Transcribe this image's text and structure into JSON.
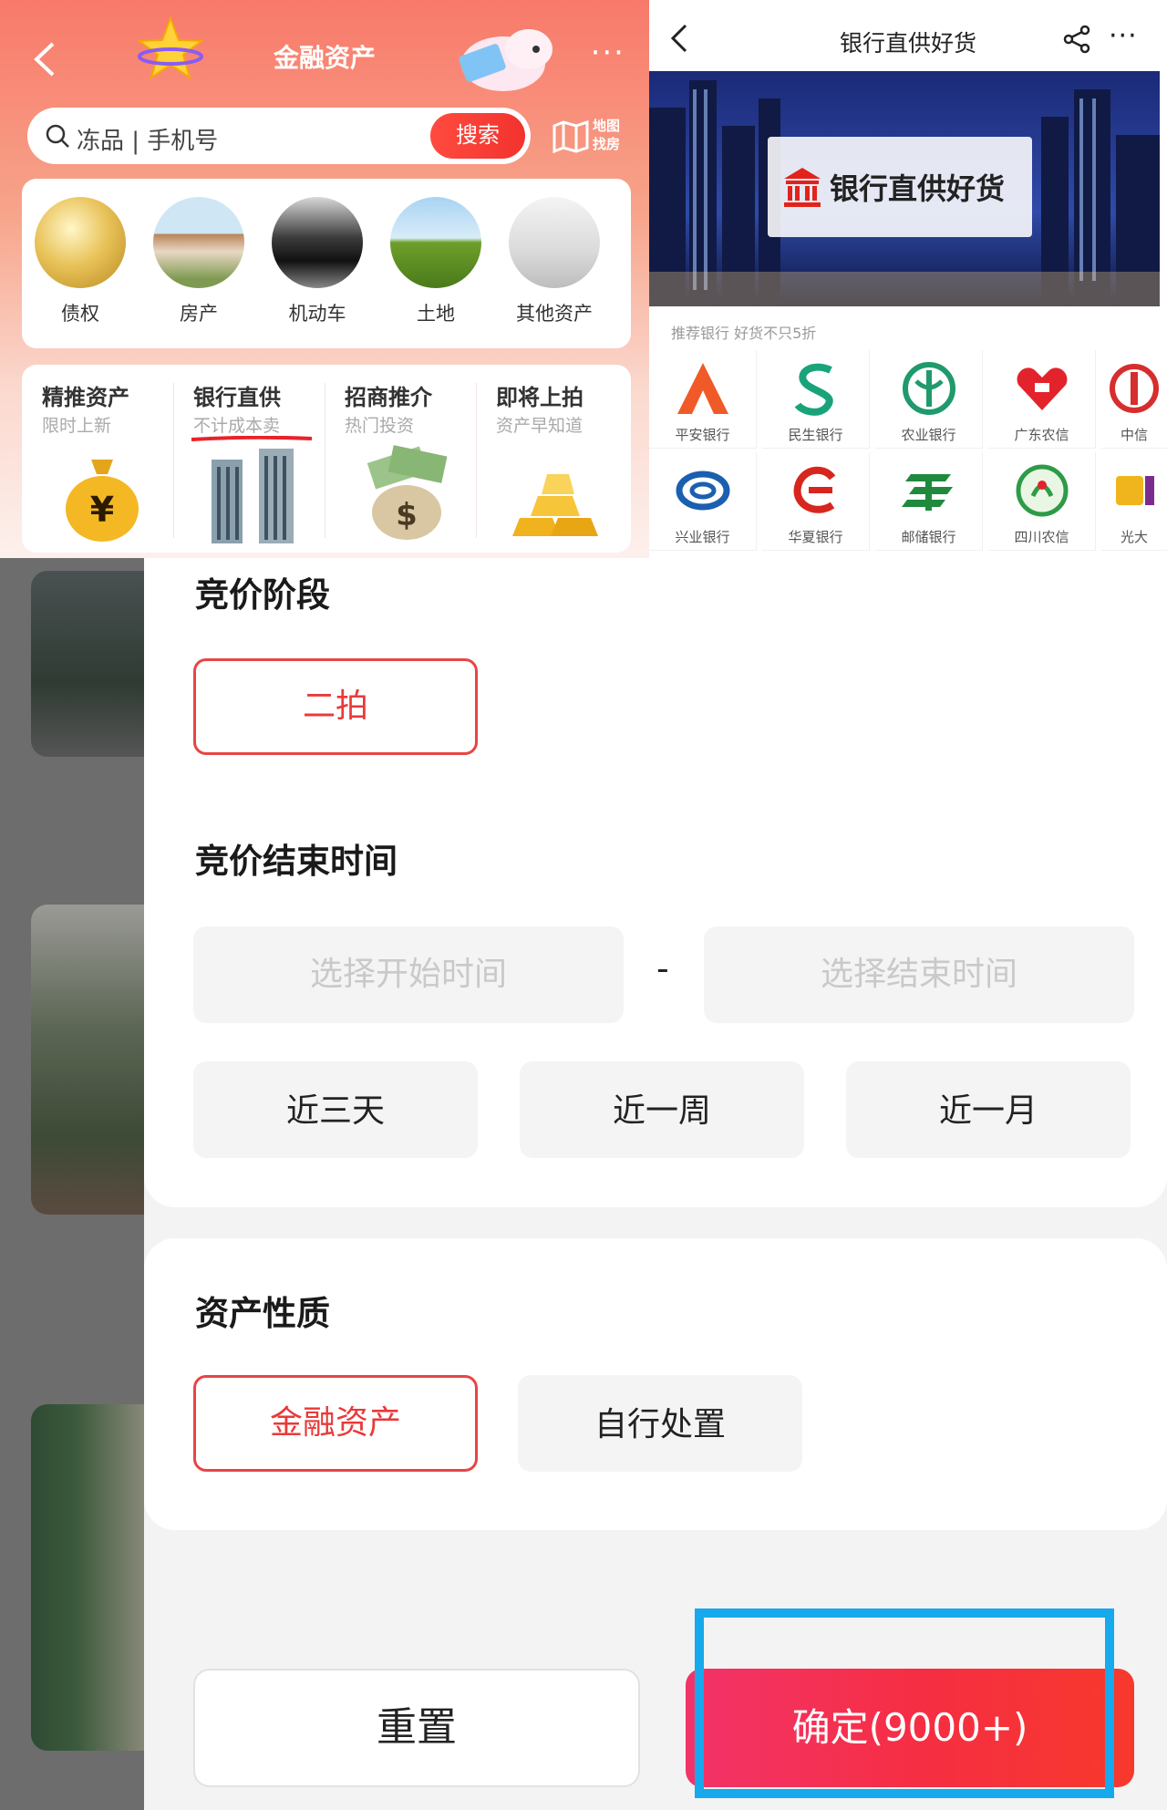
{
  "finance_app": {
    "title": "金融资产",
    "more": "···",
    "search": {
      "placeholder": "冻品 | 手机号",
      "button": "搜索"
    },
    "map_search_label": "地图找房",
    "categories": [
      {
        "label": "债权",
        "icon": "gold-coins-icon"
      },
      {
        "label": "房产",
        "icon": "house-icon"
      },
      {
        "label": "机动车",
        "icon": "car-icon"
      },
      {
        "label": "土地",
        "icon": "land-icon"
      },
      {
        "label": "其他资产",
        "icon": "appliance-icon"
      }
    ],
    "promos": [
      {
        "title": "精推资产",
        "subtitle": "限时上新",
        "icon": "money-bag-icon"
      },
      {
        "title": "银行直供",
        "subtitle": "不计成本卖",
        "icon": "buildings-icon"
      },
      {
        "title": "招商推介",
        "subtitle": "热门投资",
        "icon": "cash-bag-icon"
      },
      {
        "title": "即将上拍",
        "subtitle": "资产早知道",
        "icon": "gold-bars-icon"
      }
    ]
  },
  "bank_page": {
    "title": "银行直供好货",
    "more": "···",
    "banner_text": "银行直供好货",
    "recommend_text": "推荐银行 好货不只5折",
    "banks": [
      {
        "name": "平安银行",
        "color": "#f05a28"
      },
      {
        "name": "民生银行",
        "color": "#1aa37a"
      },
      {
        "name": "农业银行",
        "color": "#1f9a6c"
      },
      {
        "name": "广东农信",
        "color": "#e3232c"
      },
      {
        "name": "中信",
        "color": "#d72d2d"
      },
      {
        "name": "兴业银行",
        "color": "#1b5fb0"
      },
      {
        "name": "华夏银行",
        "color": "#d7261e"
      },
      {
        "name": "邮储银行",
        "color": "#1f8a3d"
      },
      {
        "name": "四川农信",
        "color": "#2d9b47"
      },
      {
        "name": "光大",
        "color": "#f0b51c"
      }
    ]
  },
  "filter": {
    "stage": {
      "title": "竞价阶段",
      "options": [
        "二拍"
      ],
      "selected": "二拍"
    },
    "end_time": {
      "title": "竞价结束时间",
      "start_placeholder": "选择开始时间",
      "separator": "-",
      "end_placeholder": "选择结束时间",
      "quick": [
        "近三天",
        "近一周",
        "近一月"
      ]
    },
    "asset_nature": {
      "title": "资产性质",
      "options": [
        "金融资产",
        "自行处置"
      ],
      "selected": "金融资产"
    },
    "reset_label": "重置",
    "confirm_label": "确定(9000+)"
  },
  "colors": {
    "accent_red": "#e84545",
    "highlight_blue": "#16a9ee"
  }
}
